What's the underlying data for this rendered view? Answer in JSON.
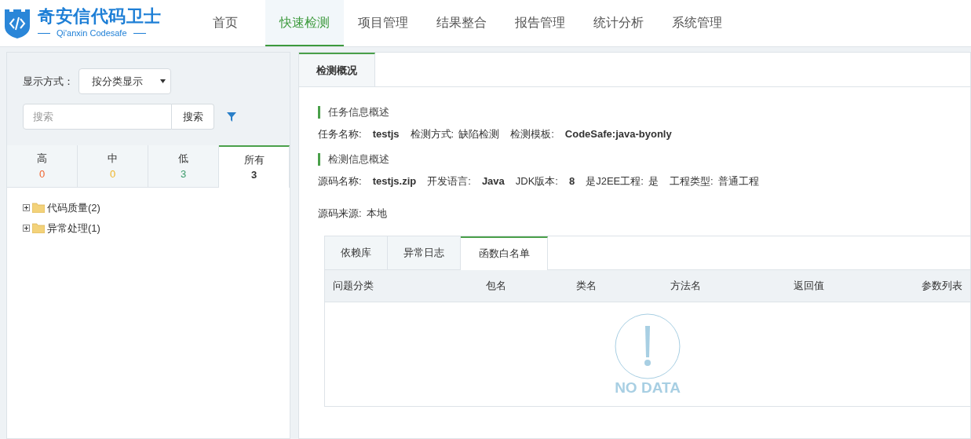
{
  "header": {
    "logo_title": "奇安信代码卫士",
    "logo_subtitle": "Qi'anxin Codesafe",
    "nav": [
      {
        "label": "首页",
        "selected": false
      },
      {
        "label": "快速检测",
        "selected": true
      },
      {
        "label": "项目管理",
        "selected": false
      },
      {
        "label": "结果整合",
        "selected": false
      },
      {
        "label": "报告管理",
        "selected": false
      },
      {
        "label": "统计分析",
        "selected": false
      },
      {
        "label": "系统管理",
        "selected": false
      }
    ]
  },
  "sidebar": {
    "display_label": "显示方式：",
    "display_select": "按分类显示",
    "search": {
      "placeholder": "搜索",
      "button": "搜索"
    },
    "severity_tabs": [
      {
        "label": "高",
        "count": "0",
        "color": "#f0642f",
        "selected": false
      },
      {
        "label": "中",
        "count": "0",
        "color": "#f0b428",
        "selected": false
      },
      {
        "label": "低",
        "count": "3",
        "color": "#3a9a6a",
        "selected": false
      },
      {
        "label": "所有",
        "count": "3",
        "color": "#333333",
        "selected": true
      }
    ],
    "tree": [
      {
        "label": "代码质量(2)",
        "expanded": false
      },
      {
        "label": "异常处理(1)",
        "expanded": false
      }
    ]
  },
  "main": {
    "tabs": [
      {
        "label": "检测概况",
        "selected": true
      }
    ],
    "sections": [
      {
        "title": "任务信息概述",
        "rows": [
          [
            {
              "label": "任务名称:",
              "value": "testjs",
              "bold": true
            },
            {
              "label": "检测方式:",
              "value": "缺陷检测",
              "bold": false
            },
            {
              "label": "检测模板:",
              "value": "CodeSafe:java-byonly",
              "bold": true
            }
          ]
        ]
      },
      {
        "title": "检测信息概述",
        "rows": [
          [
            {
              "label": "源码名称:",
              "value": "testjs.zip",
              "bold": true
            },
            {
              "label": "开发语言:",
              "value": "Java",
              "bold": true
            },
            {
              "label": "JDK版本:",
              "value": "8",
              "bold": true
            },
            {
              "label": "是J2EE工程:",
              "value": "是",
              "bold": false
            },
            {
              "label": "工程类型:",
              "value": "普通工程",
              "bold": false
            }
          ],
          [
            {
              "label": "源码来源:",
              "value": "本地",
              "bold": false
            }
          ]
        ]
      }
    ],
    "sub_tabs": [
      {
        "label": "依赖库",
        "selected": false
      },
      {
        "label": "异常日志",
        "selected": false
      },
      {
        "label": "函数白名单",
        "selected": true
      }
    ],
    "table": {
      "columns": [
        "问题分类",
        "包名",
        "类名",
        "方法名",
        "返回值",
        "参数列表"
      ],
      "empty_text": "NO DATA"
    }
  }
}
